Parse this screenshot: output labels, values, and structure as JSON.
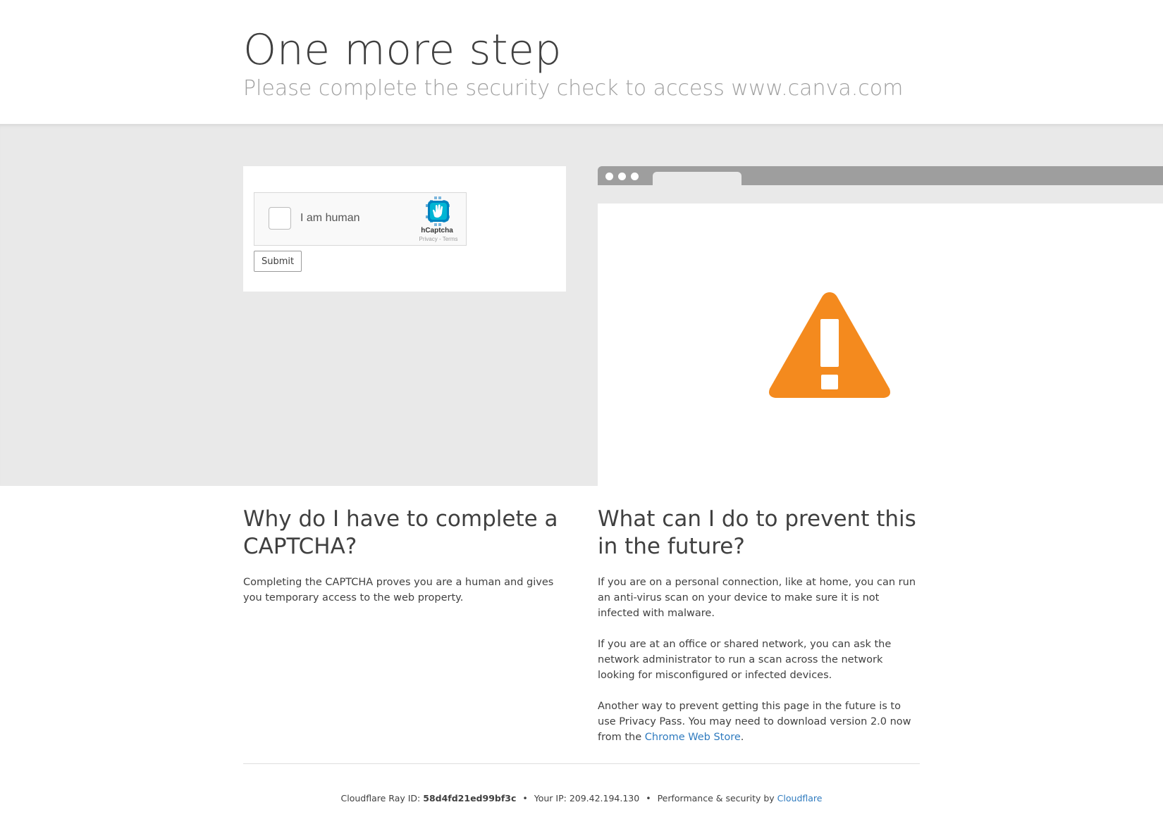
{
  "header": {
    "title": "One more step",
    "subtitle": "Please complete the security check to access www.canva.com"
  },
  "captcha": {
    "label": "I am human",
    "brand": "hCaptcha",
    "privacy": "Privacy",
    "dash": "-",
    "terms": "Terms",
    "submit": "Submit"
  },
  "browser_illustration": {
    "icon": "warning-triangle-icon",
    "icon_color": "#f48a1e"
  },
  "why": {
    "heading": "Why do I have to complete a CAPTCHA?",
    "body": "Completing the CAPTCHA proves you are a human and gives you temporary access to the web property."
  },
  "prevent": {
    "heading": "What can I do to prevent this in the future?",
    "p1": "If you are on a personal connection, like at home, you can run an anti-virus scan on your device to make sure it is not infected with malware.",
    "p2": "If you are at an office or shared network, you can ask the network administrator to run a scan across the network looking for misconfigured or infected devices.",
    "p3_before": "Another way to prevent getting this page in the future is to use Privacy Pass. You may need to download version 2.0 now from the ",
    "p3_link": "Chrome Web Store",
    "p3_after": "."
  },
  "footer": {
    "ray_label": "Cloudflare Ray ID:",
    "ray_id": "58d4fd21ed99bf3c",
    "bullet": "•",
    "ip_label": "Your IP:",
    "ip": "209.42.194.130",
    "perf_label": "Performance & security by",
    "cloudflare": "Cloudflare"
  },
  "colors": {
    "link": "#2f7bbf",
    "band": "#e9e9e9",
    "warning": "#f48a1e"
  }
}
